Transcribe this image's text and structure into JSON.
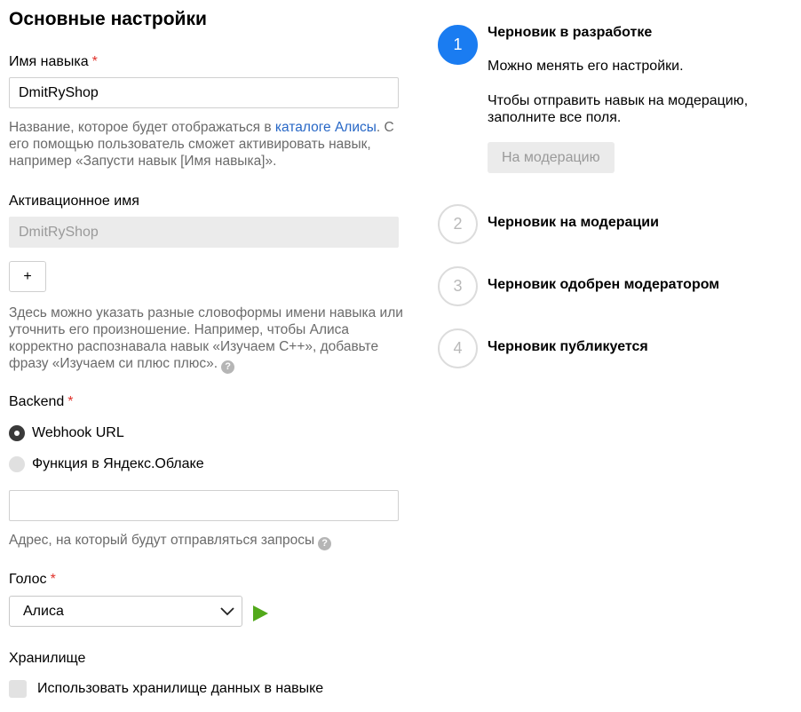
{
  "section_title": "Основные настройки",
  "skill_name": {
    "label": "Имя навыка",
    "required_mark": "*",
    "value": "DmitRyShop",
    "hint_before": "Название, которое будет отображаться в ",
    "hint_link": "каталоге Алисы",
    "hint_after": ". С его помощью пользователь сможет активировать навык, например «Запусти навык [Имя навыка]»."
  },
  "activation_name": {
    "label": "Активационное имя",
    "value": "DmitRyShop",
    "add_button": "+",
    "hint": "Здесь можно указать разные словоформы имени навыка или уточнить его произношение. Например, чтобы Алиса корректно распознавала навык «Изучаем С++», добавьте фразу «Изучаем си плюс плюс».",
    "help_icon": "?"
  },
  "backend": {
    "label": "Backend",
    "required_mark": "*",
    "options": [
      "Webhook URL",
      "Функция в Яндекс.Облаке"
    ],
    "selected": "Webhook URL",
    "url_value": "",
    "hint": "Адрес, на который будут отправляться запросы",
    "help_icon": "?"
  },
  "voice": {
    "label": "Голос",
    "required_mark": "*",
    "selected": "Алиса"
  },
  "storage": {
    "label": "Хранилище",
    "checkbox_label": "Использовать хранилище данных в навыке"
  },
  "steps": [
    {
      "number": "1",
      "title": "Черновик в разработке",
      "text1": "Можно менять его настройки.",
      "text2": "Чтобы отправить навык на модерацию, заполните все поля.",
      "button": "На модерацию"
    },
    {
      "number": "2",
      "title": "Черновик на модерации"
    },
    {
      "number": "3",
      "title": "Черновик одобрен модератором"
    },
    {
      "number": "4",
      "title": "Черновик публикуется"
    }
  ],
  "colors": {
    "accent": "#1a7cf1",
    "link": "#2767c6",
    "required": "#e0312a",
    "play": "#52a91b"
  }
}
